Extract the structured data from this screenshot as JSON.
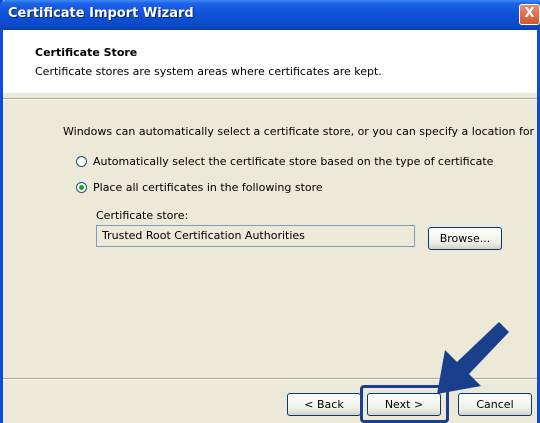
{
  "window": {
    "title": "Certificate Import Wizard",
    "close_glyph": "X"
  },
  "header": {
    "title": "Certificate Store",
    "subtitle": "Certificate stores are system areas where certificates are kept."
  },
  "main": {
    "intro_text": "Windows can automatically select a certificate store, or you can specify a location for",
    "options": [
      {
        "label": "Automatically select the certificate store based on the type of certificate",
        "selected": false
      },
      {
        "label": "Place all certificates in the following store",
        "selected": true
      }
    ],
    "store_label": "Certificate store:",
    "store_value": "Trusted Root Certification Authorities",
    "browse_label": "Browse..."
  },
  "footer": {
    "back_label": "< Back",
    "next_label": "Next >",
    "cancel_label": "Cancel"
  },
  "colors": {
    "titlebar": "#0d51d8",
    "dialog_bg": "#ece9d8",
    "annotation_arrow": "#1a3f8c"
  },
  "icons": {
    "annotation": "pointer-arrow-icon"
  }
}
